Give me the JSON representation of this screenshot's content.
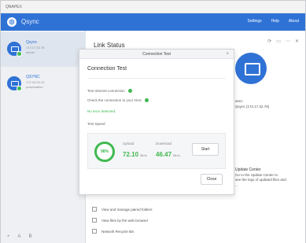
{
  "window": {
    "title": "QNAPEX"
  },
  "topbar": {
    "brand": "Qsync",
    "links": [
      "Settings",
      "Help",
      "About"
    ]
  },
  "sidebar": {
    "devices": [
      {
        "name": "Qsync",
        "ip": "172.17.32.78",
        "role": "admin",
        "selected": true
      },
      {
        "name": "QSYNC",
        "ip": "172.16.20.19",
        "role": "poseesation",
        "selected": false
      }
    ],
    "footer_icons": [
      "+",
      "A",
      "B"
    ]
  },
  "main": {
    "title": "Link Status",
    "info": [
      "ame:",
      "Qsync (172.17.32.78)"
    ],
    "update_center": {
      "heading": "Update Center",
      "lines": [
        "Go to the Update Center to",
        "see the logs of updated files and",
        "..."
      ]
    },
    "options": [
      "View and manage paired folders",
      "View files by the web browser",
      "Network Recycle Bin"
    ]
  },
  "dialog": {
    "window_title": "Connection Test",
    "heading": "Connection Test",
    "checks": [
      "Test Internet connection",
      "Check the connection to your NAS"
    ],
    "detected": "No error detected.",
    "speed_label": "Test Speed",
    "ring_value": "98%",
    "upload": {
      "label": "Upload",
      "value": "72.10",
      "unit": "Mb/s"
    },
    "download": {
      "label": "Download",
      "value": "46.47",
      "unit": "Mb/s"
    },
    "start_label": "Start",
    "close_label": "Close"
  },
  "colors": {
    "accent": "#2f72d6",
    "success": "#3fb950"
  }
}
